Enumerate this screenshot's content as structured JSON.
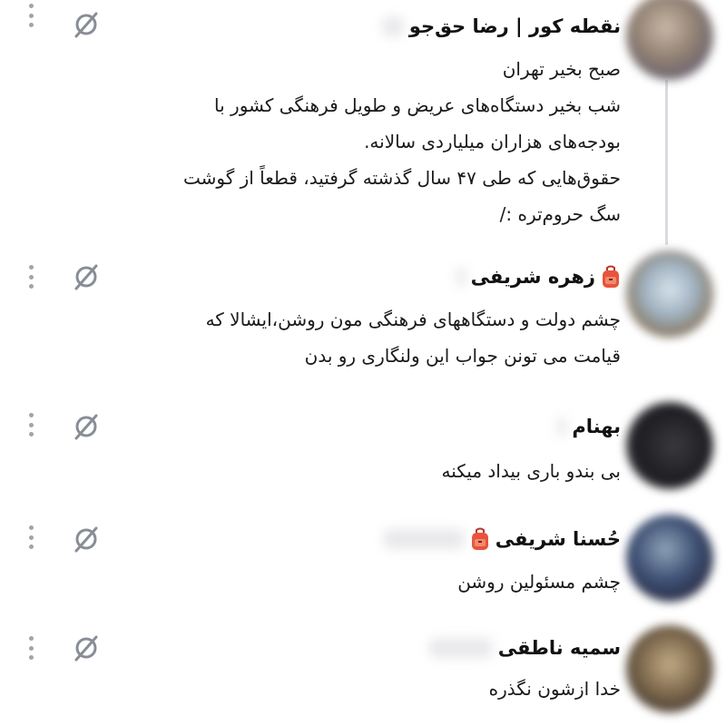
{
  "accent_colors": {
    "icon_gray": "#888d96",
    "badge_red": "#e8533c"
  },
  "icons": {
    "more": "vertical-ellipsis-icon",
    "empty_set": "empty-set-icon",
    "badge": "backpack-emoji"
  },
  "posts": [
    {
      "author": "نقطه کور | رضا حق‌جو",
      "has_badge": false,
      "lines": [
        "صبح بخیر تهران",
        "شب بخیر دستگاه‌های عریض و طویل فرهنگی کشور با",
        "بودجه‌های هزاران میلیاردی سالانه.",
        "حقوق‌هایی که طی ۴۷ سال گذشته گرفتید، قطعاً از گوشت",
        "سگ حروم‌تره :/"
      ]
    },
    {
      "author": "زهره شریفی",
      "has_badge": true,
      "lines": [
        "چشم دولت و دستگاههای فرهنگی مون روشن،ایشالا که",
        "قیامت می تونن جواب این ولنگاری رو بدن"
      ]
    },
    {
      "author": "بهنام",
      "has_badge": false,
      "lines": [
        "بی بندو باری بیداد میکنه"
      ]
    },
    {
      "author": "حُسنا شریفی",
      "has_badge": true,
      "lines": [
        "چشم مسئولین روشن"
      ]
    },
    {
      "author": "سمیه ناطقی",
      "has_badge": false,
      "lines": [
        "خدا ازشون نگذره"
      ]
    }
  ]
}
